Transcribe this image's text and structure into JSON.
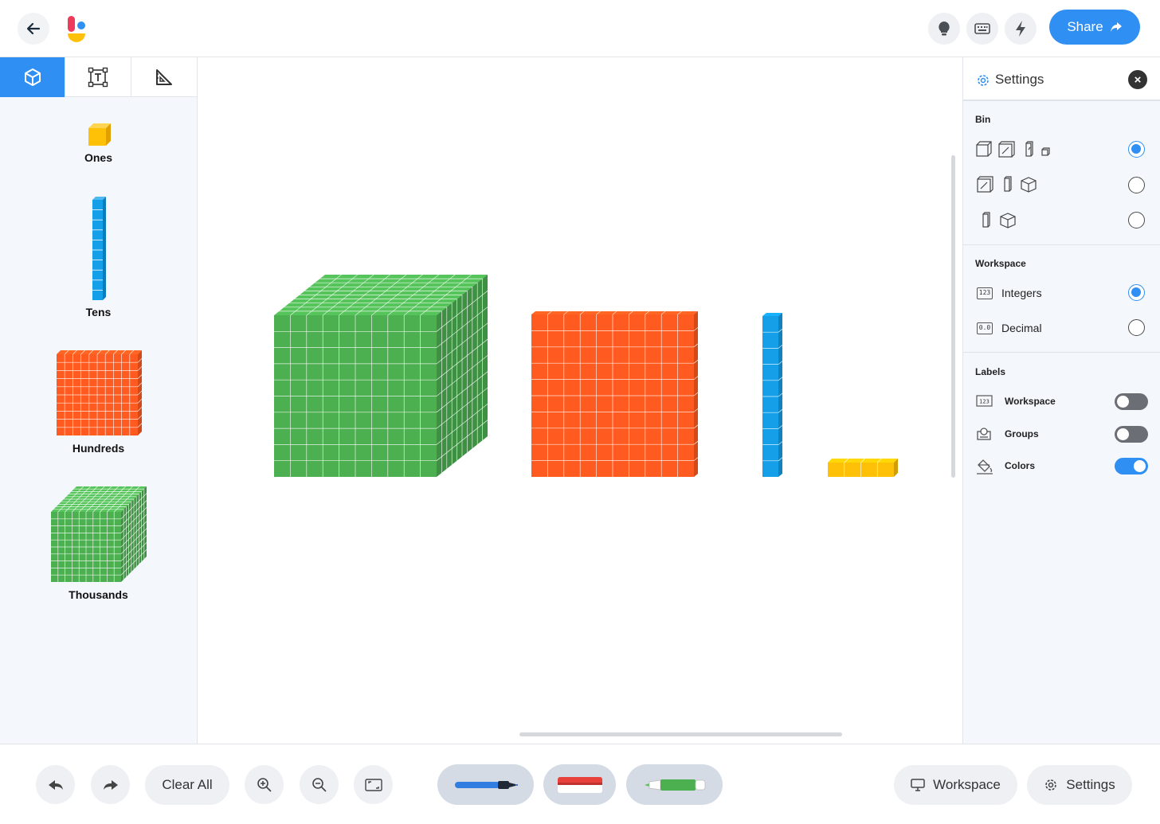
{
  "topbar": {
    "share_label": "Share",
    "icons": [
      "back-arrow-icon",
      "lightbulb-icon",
      "keyboard-icon",
      "lightning-icon"
    ]
  },
  "left_panel": {
    "tabs": [
      "cube-icon",
      "text-box-icon",
      "set-square-icon"
    ],
    "items": [
      {
        "label": "Ones",
        "color": "#ffc107"
      },
      {
        "label": "Tens",
        "color": "#149fe8"
      },
      {
        "label": "Hundreds",
        "color": "#ff5a1f"
      },
      {
        "label": "Thousands",
        "color": "#4caf50"
      }
    ]
  },
  "workspace": {
    "blocks": [
      "thousand-cube",
      "hundred-flat",
      "ten-rod",
      "four-ones"
    ]
  },
  "settings": {
    "title": "Settings",
    "bin": {
      "title": "Bin",
      "selected_option": 1
    },
    "workspace": {
      "title": "Workspace",
      "options": [
        {
          "label": "Integers",
          "badge": "123",
          "selected": true
        },
        {
          "label": "Decimal",
          "badge": "0.0",
          "selected": false
        }
      ]
    },
    "labels": {
      "title": "Labels",
      "items": [
        {
          "label": "Workspace",
          "on": false
        },
        {
          "label": "Groups",
          "on": false
        },
        {
          "label": "Colors",
          "on": true
        }
      ]
    }
  },
  "bottombar": {
    "clear_label": "Clear All",
    "workspace_label": "Workspace",
    "settings_label": "Settings"
  },
  "colors": {
    "accent": "#2f8ff2",
    "green": "#4caf50",
    "orange": "#ff5a1f",
    "blue": "#149fe8",
    "yellow": "#ffc107"
  }
}
